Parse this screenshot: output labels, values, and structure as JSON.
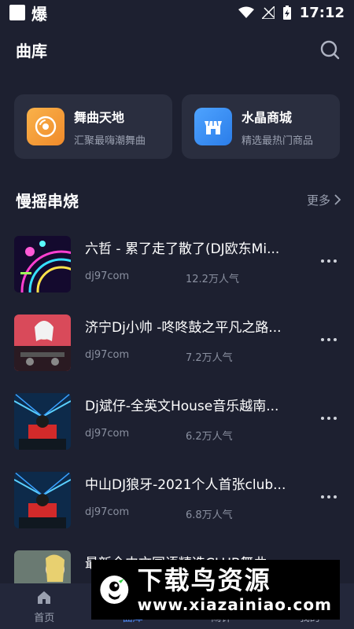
{
  "status": {
    "time": "17:12",
    "left_char": "爆"
  },
  "header": {
    "title": "曲库"
  },
  "cards": [
    {
      "title": "舞曲天地",
      "subtitle": "汇聚最嗨潮舞曲",
      "icon": "vinyl-disc-icon",
      "color": "#f59d38"
    },
    {
      "title": "水晶商城",
      "subtitle": "精选最热门商品",
      "icon": "shop-store-icon",
      "color": "#3b8ff5"
    }
  ],
  "section": {
    "title": "慢摇串烧",
    "more": "更多"
  },
  "songs": [
    {
      "title": "六哲 - 累了走了散了(DJ欧东Mi...",
      "source": "dj97com",
      "plays": "12.2万人气"
    },
    {
      "title": "济宁Dj小帅 -咚咚鼓之平凡之路...",
      "source": "dj97com",
      "plays": "7.2万人气"
    },
    {
      "title": "Dj斌仔-全英文House音乐越南...",
      "source": "dj97com",
      "plays": "6.2万人气"
    },
    {
      "title": "中山DJ狼牙-2021个人首张club...",
      "source": "dj97com",
      "plays": "6.8万人气"
    },
    {
      "title": "最新全中文国语精选CLUB舞曲",
      "source": "",
      "plays": ""
    }
  ],
  "nav": [
    {
      "label": "首页",
      "icon": "home-icon",
      "active": false
    },
    {
      "label": "曲库",
      "icon": "library-icon",
      "active": true
    },
    {
      "label": "闹钟",
      "icon": "alarm-icon",
      "active": false
    },
    {
      "label": "我的",
      "icon": "user-icon",
      "active": false
    }
  ],
  "watermark": {
    "title": "下载鸟资源",
    "url": "www.xiazainiao.com"
  },
  "colors": {
    "background": "#1d2030",
    "card": "#2a2e3f",
    "accent": "#4f8dff"
  }
}
